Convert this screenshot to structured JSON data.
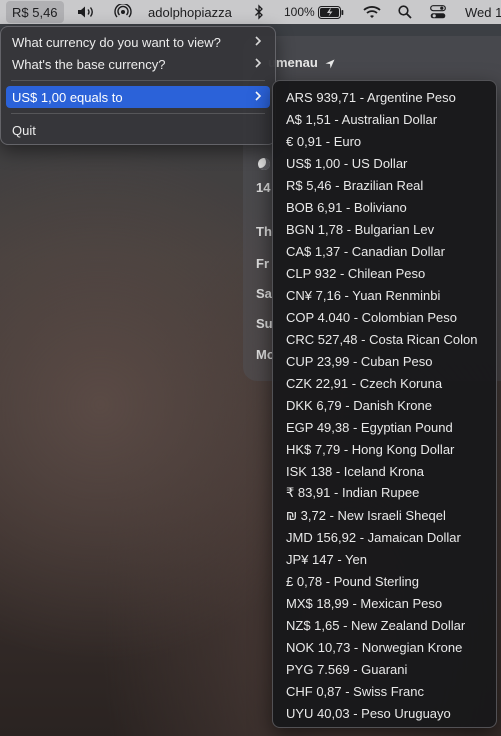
{
  "menubar": {
    "rate_label": "R$ 5,46",
    "username": "adolphopiazza",
    "battery_percent": "100%",
    "day": "Wed 1"
  },
  "widget": {
    "city": "umenau",
    "temp_row": "14",
    "days": [
      "Th",
      "Fr",
      "Sa",
      "Su",
      "Mo"
    ]
  },
  "menu": {
    "items": [
      {
        "label": "What currency do you want to view?"
      },
      {
        "label": "What's the base currency?"
      },
      {
        "label": "US$ 1,00 equals to"
      },
      {
        "label": "Quit"
      }
    ]
  },
  "submenu": {
    "items": [
      "ARS 939,71 - Argentine Peso",
      "A$ 1,51 - Australian Dollar",
      "€ 0,91 - Euro",
      "US$ 1,00 - US Dollar",
      "R$ 5,46 - Brazilian Real",
      "BOB 6,91 - Boliviano",
      "BGN 1,78 - Bulgarian Lev",
      "CA$ 1,37 - Canadian Dollar",
      "CLP 932 - Chilean Peso",
      "CN¥ 7,16 - Yuan Renminbi",
      "COP 4.040 - Colombian Peso",
      "CRC 527,48 - Costa Rican Colon",
      "CUP 23,99 - Cuban Peso",
      "CZK 22,91 - Czech Koruna",
      "DKK 6,79 - Danish Krone",
      "EGP 49,38 - Egyptian Pound",
      "HK$ 7,79 - Hong Kong Dollar",
      "ISK 138 - Iceland Krona",
      "₹ 83,91 - Indian Rupee",
      "₪ 3,72 - New Israeli Sheqel",
      "JMD 156,92 - Jamaican Dollar",
      "JP¥ 147 - Yen",
      "£ 0,78 - Pound Sterling",
      "MX$ 18,99 - Mexican Peso",
      "NZ$ 1,65 - New Zealand Dollar",
      "NOK 10,73 - Norwegian Krone",
      "PYG 7.569 - Guarani",
      "CHF 0,87 - Swiss Franc",
      "UYU 40,03 - Peso Uruguayo"
    ]
  },
  "colors": {
    "menubar": "#c9c9cb",
    "highlight": "#2b62d9",
    "submenu_bg": "#18181a",
    "menu_bg": "#36363a"
  },
  "icons": [
    "volume-icon",
    "airdrop-icon",
    "bluetooth-icon",
    "battery-icon",
    "wifi-icon",
    "search-icon",
    "control-center-icon",
    "chevron-right-icon",
    "location-arrow-icon",
    "moon-icon"
  ]
}
